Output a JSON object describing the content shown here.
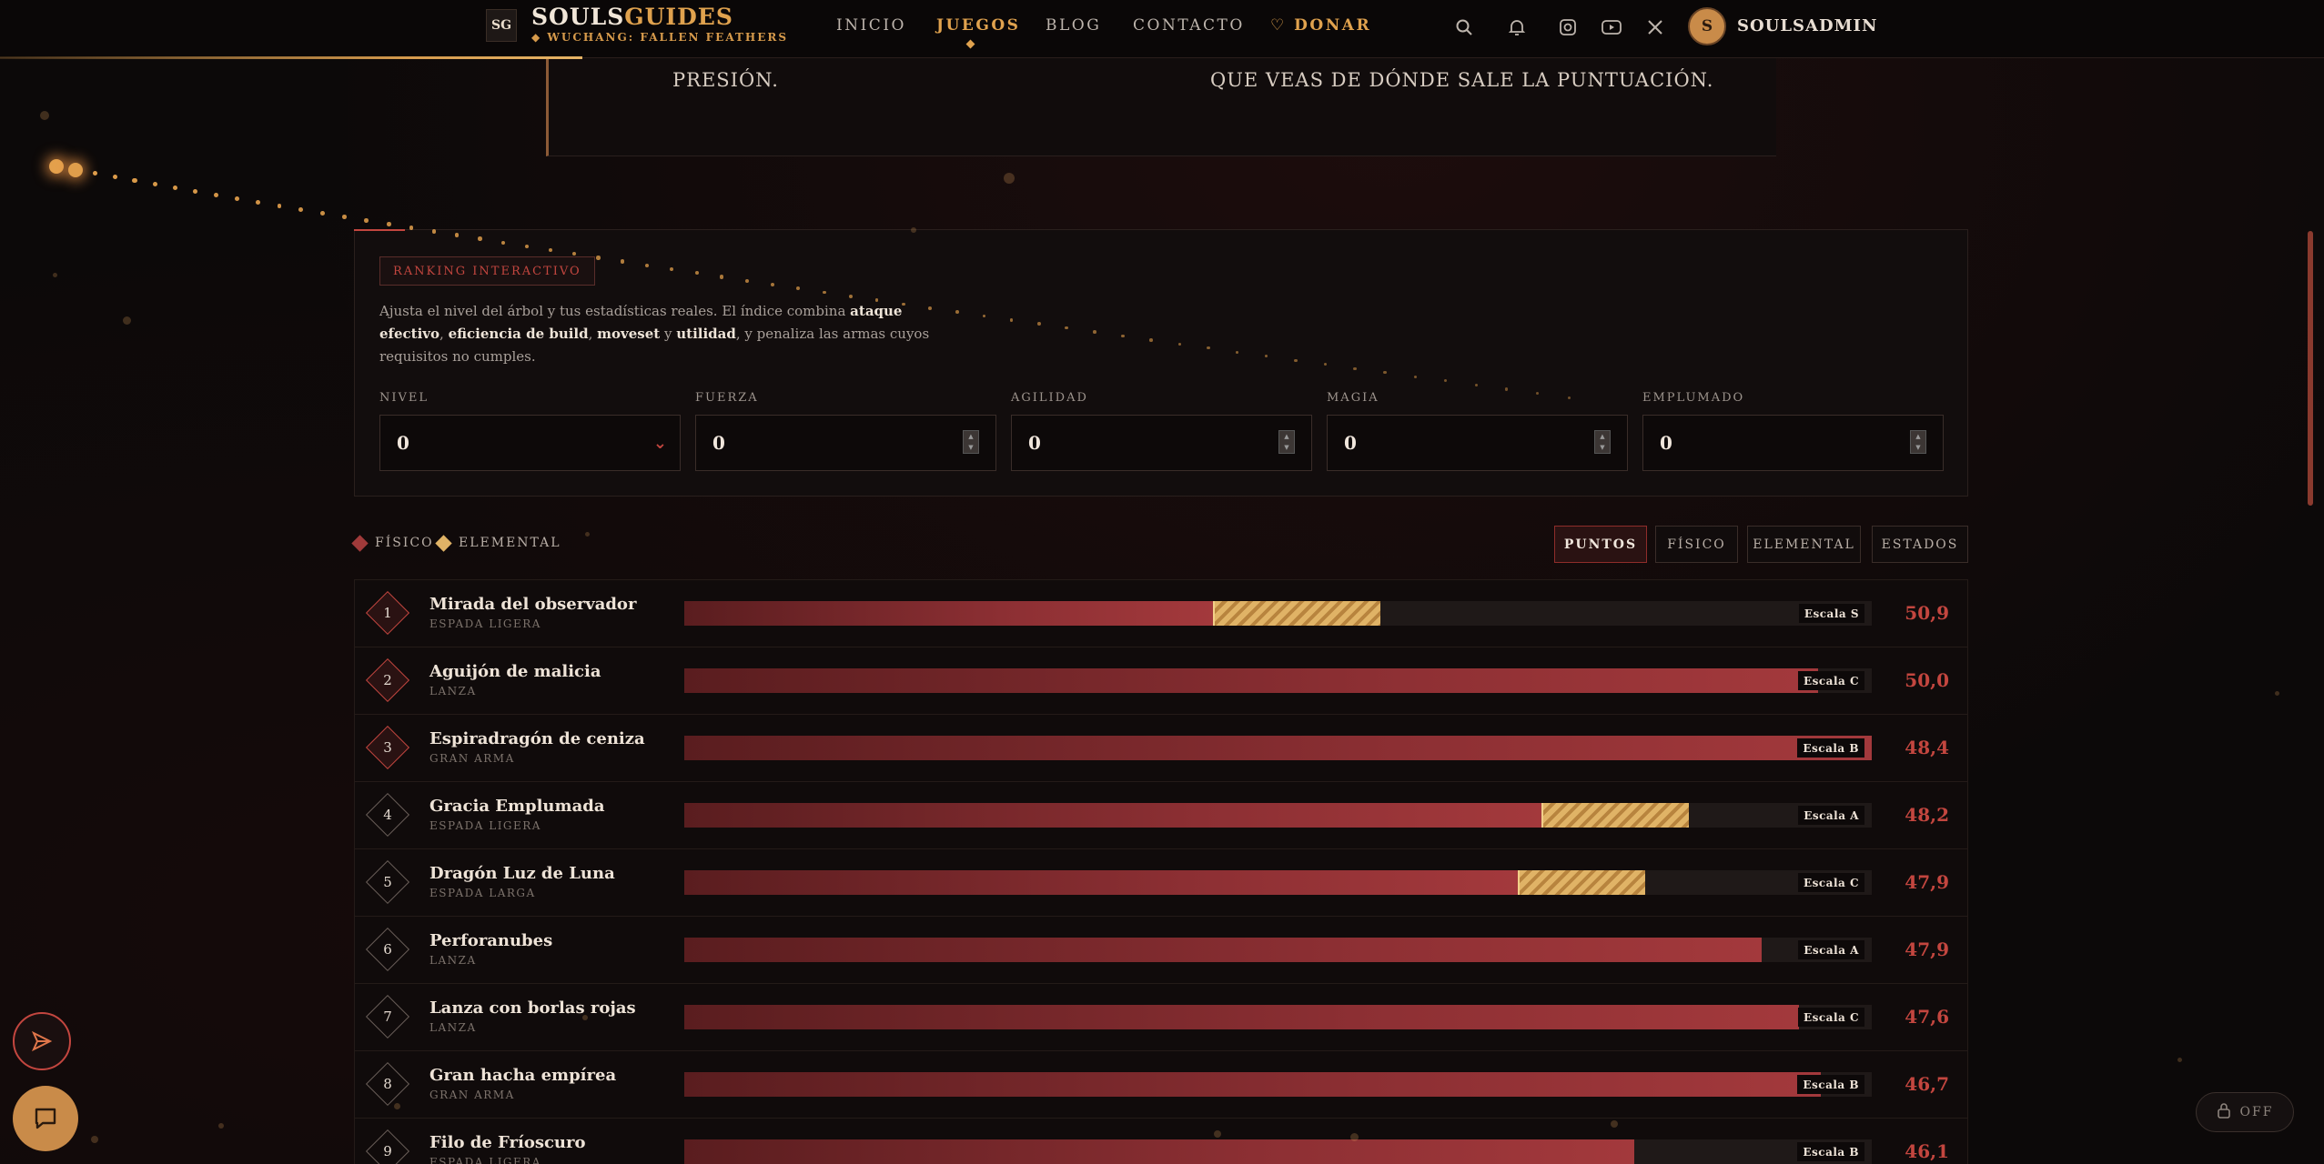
{
  "brand": {
    "logo": "SG",
    "title_a": "SOULS",
    "title_b": "GUIDES",
    "subtitle": "◆ WUCHANG: FALLEN FEATHERS"
  },
  "nav": {
    "links": [
      "INICIO",
      "JUEGOS",
      "BLOG",
      "CONTACTO"
    ],
    "donate": "♡ DONAR",
    "active": "JUEGOS"
  },
  "header_icons": [
    "search-icon",
    "bell-icon",
    "instagram-icon",
    "youtube-icon",
    "x-icon"
  ],
  "user": {
    "initial": "S",
    "name": "SOULSADMIN"
  },
  "top_card": {
    "text_left": "PRESIÓN.",
    "text_right": "QUE VEAS DE DÓNDE SALE LA PUNTUACIÓN."
  },
  "ranking": {
    "badge": "RANKING INTERACTIVO",
    "desc_1": "Ajusta el nivel del árbol y tus estadísticas reales. El índice combina ",
    "desc_b1": "ataque efectivo",
    "desc_2": ", ",
    "desc_b2": "eficiencia de build",
    "desc_3": ", ",
    "desc_b3": "moveset",
    "desc_4": " y ",
    "desc_b4": "utilidad",
    "desc_5": ", y penaliza las armas cuyos requisitos no cumples.",
    "fields": [
      {
        "label": "NIVEL",
        "value": "0"
      },
      {
        "label": "FUERZA",
        "value": "0"
      },
      {
        "label": "AGILIDAD",
        "value": "0"
      },
      {
        "label": "MAGIA",
        "value": "0"
      },
      {
        "label": "EMPLUMADO",
        "value": "0"
      }
    ]
  },
  "legend": {
    "physical": "FÍSICO",
    "elemental": "ELEMENTAL"
  },
  "tabs": [
    "PUNTOS",
    "FÍSICO",
    "ELEMENTAL",
    "ESTADOS"
  ],
  "colors": {
    "accent": "#c3463f",
    "gold": "#e0a24e",
    "physical": "#8c2f33",
    "elemental": "#e0b366"
  },
  "weapons": [
    {
      "rank": "1",
      "name": "Mirada del observador",
      "type": "ESPADA LIGERA",
      "scale": "Escala S",
      "score": "50,9",
      "phys": 0.445,
      "elem": 0.141
    },
    {
      "rank": "2",
      "name": "Aguijón de malicia",
      "type": "LANZA",
      "scale": "Escala C",
      "score": "50,0",
      "phys": 0.955,
      "elem": 0
    },
    {
      "rank": "3",
      "name": "Espiradragón de ceniza",
      "type": "GRAN ARMA",
      "scale": "Escala B",
      "score": "48,4",
      "phys": 1.0,
      "elem": 0
    },
    {
      "rank": "4",
      "name": "Gracia Emplumada",
      "type": "ESPADA LIGERA",
      "scale": "Escala A",
      "score": "48,2",
      "phys": 0.722,
      "elem": 0.124
    },
    {
      "rank": "5",
      "name": "Dragón Luz de Luna",
      "type": "ESPADA LARGA",
      "scale": "Escala C",
      "score": "47,9",
      "phys": 0.702,
      "elem": 0.107
    },
    {
      "rank": "6",
      "name": "Perforanubes",
      "type": "LANZA",
      "scale": "Escala A",
      "score": "47,9",
      "phys": 0.907,
      "elem": 0
    },
    {
      "rank": "7",
      "name": "Lanza con borlas rojas",
      "type": "LANZA",
      "scale": "Escala C",
      "score": "47,6",
      "phys": 0.939,
      "elem": 0
    },
    {
      "rank": "8",
      "name": "Gran hacha empírea",
      "type": "GRAN ARMA",
      "scale": "Escala B",
      "score": "46,7",
      "phys": 0.957,
      "elem": 0
    },
    {
      "rank": "9",
      "name": "Filo de Fríoscuro",
      "type": "ESPADA LIGERA",
      "scale": "Escala B",
      "score": "46,1",
      "phys": 0.8,
      "elem": 0
    }
  ],
  "toggle": {
    "label": "OFF"
  }
}
